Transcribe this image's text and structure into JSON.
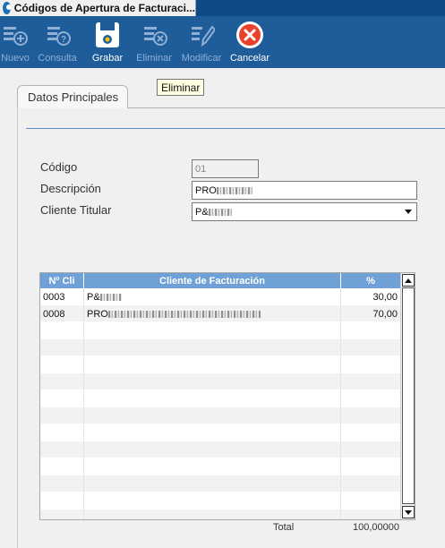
{
  "window": {
    "title": "Códigos de Apertura de Facturaci..."
  },
  "toolbar": {
    "buttons": [
      {
        "label": "Nuevo",
        "icon": "add-list-icon",
        "enabled": false
      },
      {
        "label": "Consulta",
        "icon": "query-list-icon",
        "enabled": false
      },
      {
        "label": "Grabar",
        "icon": "save-floppy-icon",
        "enabled": true
      },
      {
        "label": "Eliminar",
        "icon": "delete-list-icon",
        "enabled": false
      },
      {
        "label": "Modificar",
        "icon": "edit-pencil-icon",
        "enabled": false
      },
      {
        "label": "Cancelar",
        "icon": "cancel-x-icon",
        "enabled": true
      }
    ]
  },
  "tooltip": {
    "text": "Eliminar"
  },
  "tabs": [
    {
      "label": "Datos Principales",
      "active": true
    }
  ],
  "form": {
    "codigo_label": "Código",
    "codigo_value": "01",
    "descripcion_label": "Descripción",
    "descripcion_value": "PRO",
    "cliente_label": "Cliente Titular",
    "cliente_value": "P&"
  },
  "grid": {
    "headers": [
      "Nº Cli",
      "Cliente de Facturación",
      "%"
    ],
    "rows": [
      {
        "num": "0003",
        "cliente": "P&",
        "pct": "30,00"
      },
      {
        "num": "0008",
        "cliente": "PRO",
        "pct": "70,00"
      },
      {
        "num": "",
        "cliente": "",
        "pct": ""
      },
      {
        "num": "",
        "cliente": "",
        "pct": ""
      },
      {
        "num": "",
        "cliente": "",
        "pct": ""
      },
      {
        "num": "",
        "cliente": "",
        "pct": ""
      },
      {
        "num": "",
        "cliente": "",
        "pct": ""
      },
      {
        "num": "",
        "cliente": "",
        "pct": ""
      },
      {
        "num": "",
        "cliente": "",
        "pct": ""
      },
      {
        "num": "",
        "cliente": "",
        "pct": ""
      },
      {
        "num": "",
        "cliente": "",
        "pct": ""
      },
      {
        "num": "",
        "cliente": "",
        "pct": ""
      },
      {
        "num": "",
        "cliente": "",
        "pct": ""
      },
      {
        "num": "",
        "cliente": "",
        "pct": ""
      }
    ],
    "total_label": "Total",
    "total_value": "100,00000"
  },
  "colors": {
    "toolbar_bg": "#1f5c9a",
    "grid_header": "#6fa1d6",
    "cancel_red": "#e8412c"
  }
}
